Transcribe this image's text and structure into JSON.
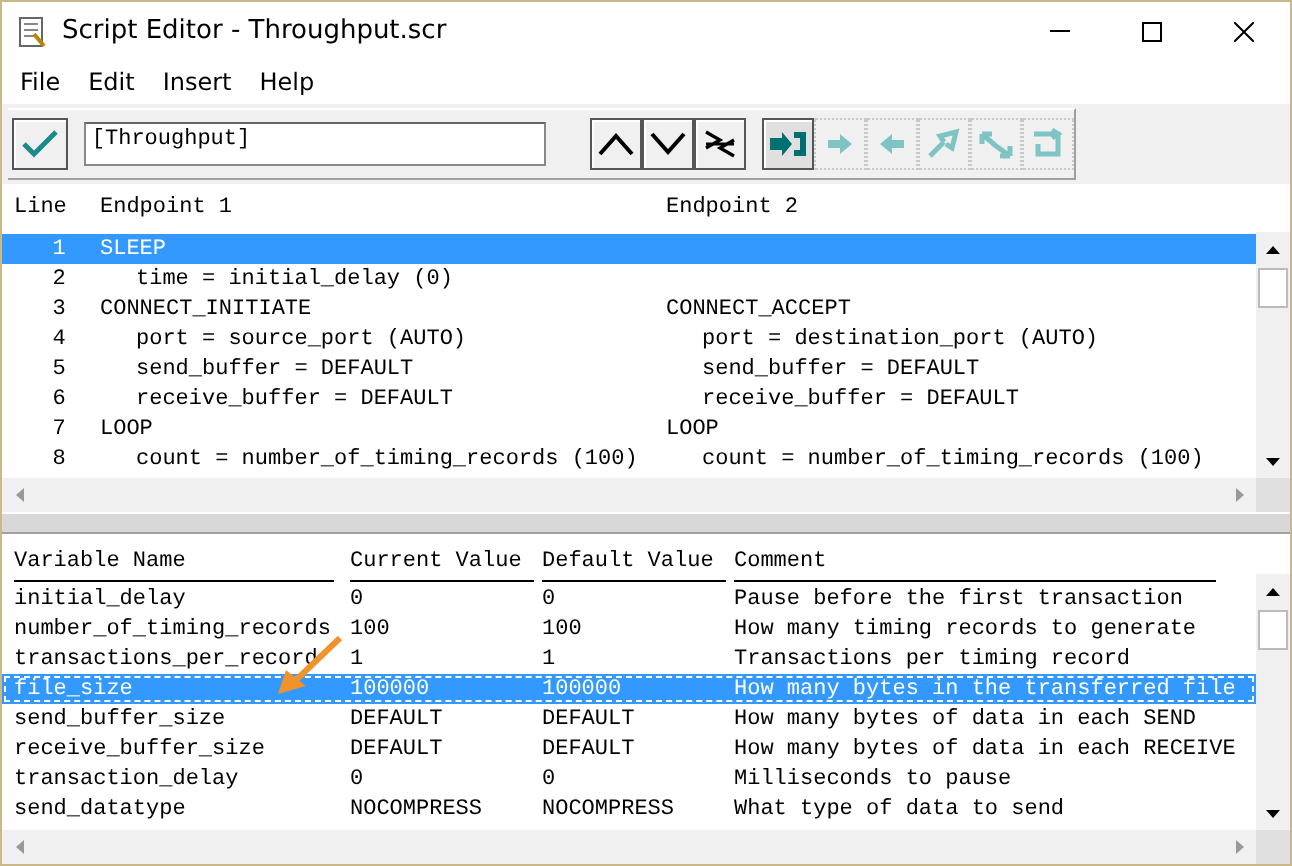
{
  "window": {
    "title": "Script Editor - Throughput.scr"
  },
  "menu": [
    "File",
    "Edit",
    "Insert",
    "Help"
  ],
  "toolbar": {
    "field_value": "[Throughput]",
    "nav_buttons": [
      {
        "kind": "up"
      },
      {
        "kind": "down"
      },
      {
        "kind": "branch"
      }
    ],
    "tools": [
      {
        "kind": "insert",
        "disabled": false
      },
      {
        "kind": "right",
        "disabled": true
      },
      {
        "kind": "left",
        "disabled": true
      },
      {
        "kind": "swap",
        "disabled": true
      },
      {
        "kind": "exchange",
        "disabled": true
      },
      {
        "kind": "loop",
        "disabled": true
      }
    ]
  },
  "script": {
    "columns": [
      "Line",
      "Endpoint 1",
      "Endpoint 2"
    ],
    "rows": [
      {
        "line": "1",
        "endpoint_1": "SLEEP",
        "selected": true,
        "children": [
          {
            "line": "2",
            "endpoint_1": "time = initial_delay (0)",
            "selected": false
          }
        ]
      },
      {
        "line": "3",
        "endpoint_1": "CONNECT_INITIATE",
        "endpoint_2": "CONNECT_ACCEPT",
        "selected": false,
        "children": [
          {
            "line": "4",
            "endpoint_1": "port = source_port (AUTO)",
            "endpoint_2": "port = destination_port (AUTO)",
            "selected": false
          },
          {
            "line": "5",
            "endpoint_1": "send_buffer = DEFAULT",
            "endpoint_2": "send_buffer = DEFAULT",
            "selected": false
          },
          {
            "line": "6",
            "endpoint_1": "receive_buffer = DEFAULT",
            "endpoint_2": "receive_buffer = DEFAULT",
            "selected": false
          }
        ]
      },
      {
        "line": "7",
        "endpoint_1": "LOOP",
        "endpoint_2": "LOOP",
        "selected": false,
        "children": [
          {
            "line": "8",
            "endpoint_1": "count = number_of_timing_records (100)",
            "endpoint_2": "count = number_of_timing_records (100)",
            "selected": false
          }
        ]
      }
    ]
  },
  "variables": {
    "columns": [
      "Variable Name",
      "Current Value",
      "Default Value",
      "Comment"
    ],
    "rows": [
      {
        "name": "initial_delay",
        "current": "0",
        "default": "0",
        "comment": "Pause before the first transaction",
        "selected": false
      },
      {
        "name": "number_of_timing_records",
        "current": "100",
        "default": "100",
        "comment": "How many timing records to generate",
        "selected": false
      },
      {
        "name": "transactions_per_record",
        "current": "1",
        "default": "1",
        "comment": "Transactions per timing record",
        "selected": false
      },
      {
        "name": "file_size",
        "current": "100000",
        "default": "100000",
        "comment": "How many bytes in the transferred file",
        "selected": true
      },
      {
        "name": "send_buffer_size",
        "current": "DEFAULT",
        "default": "DEFAULT",
        "comment": "How many bytes of data in each SEND",
        "selected": false
      },
      {
        "name": "receive_buffer_size",
        "current": "DEFAULT",
        "default": "DEFAULT",
        "comment": "How many bytes of data in each RECEIVE",
        "selected": false
      },
      {
        "name": "transaction_delay",
        "current": "0",
        "default": "0",
        "comment": "Milliseconds to pause",
        "selected": false
      },
      {
        "name": "send_datatype",
        "current": "NOCOMPRESS",
        "default": "NOCOMPRESS",
        "comment": "What type of data to send",
        "selected": false
      }
    ]
  }
}
